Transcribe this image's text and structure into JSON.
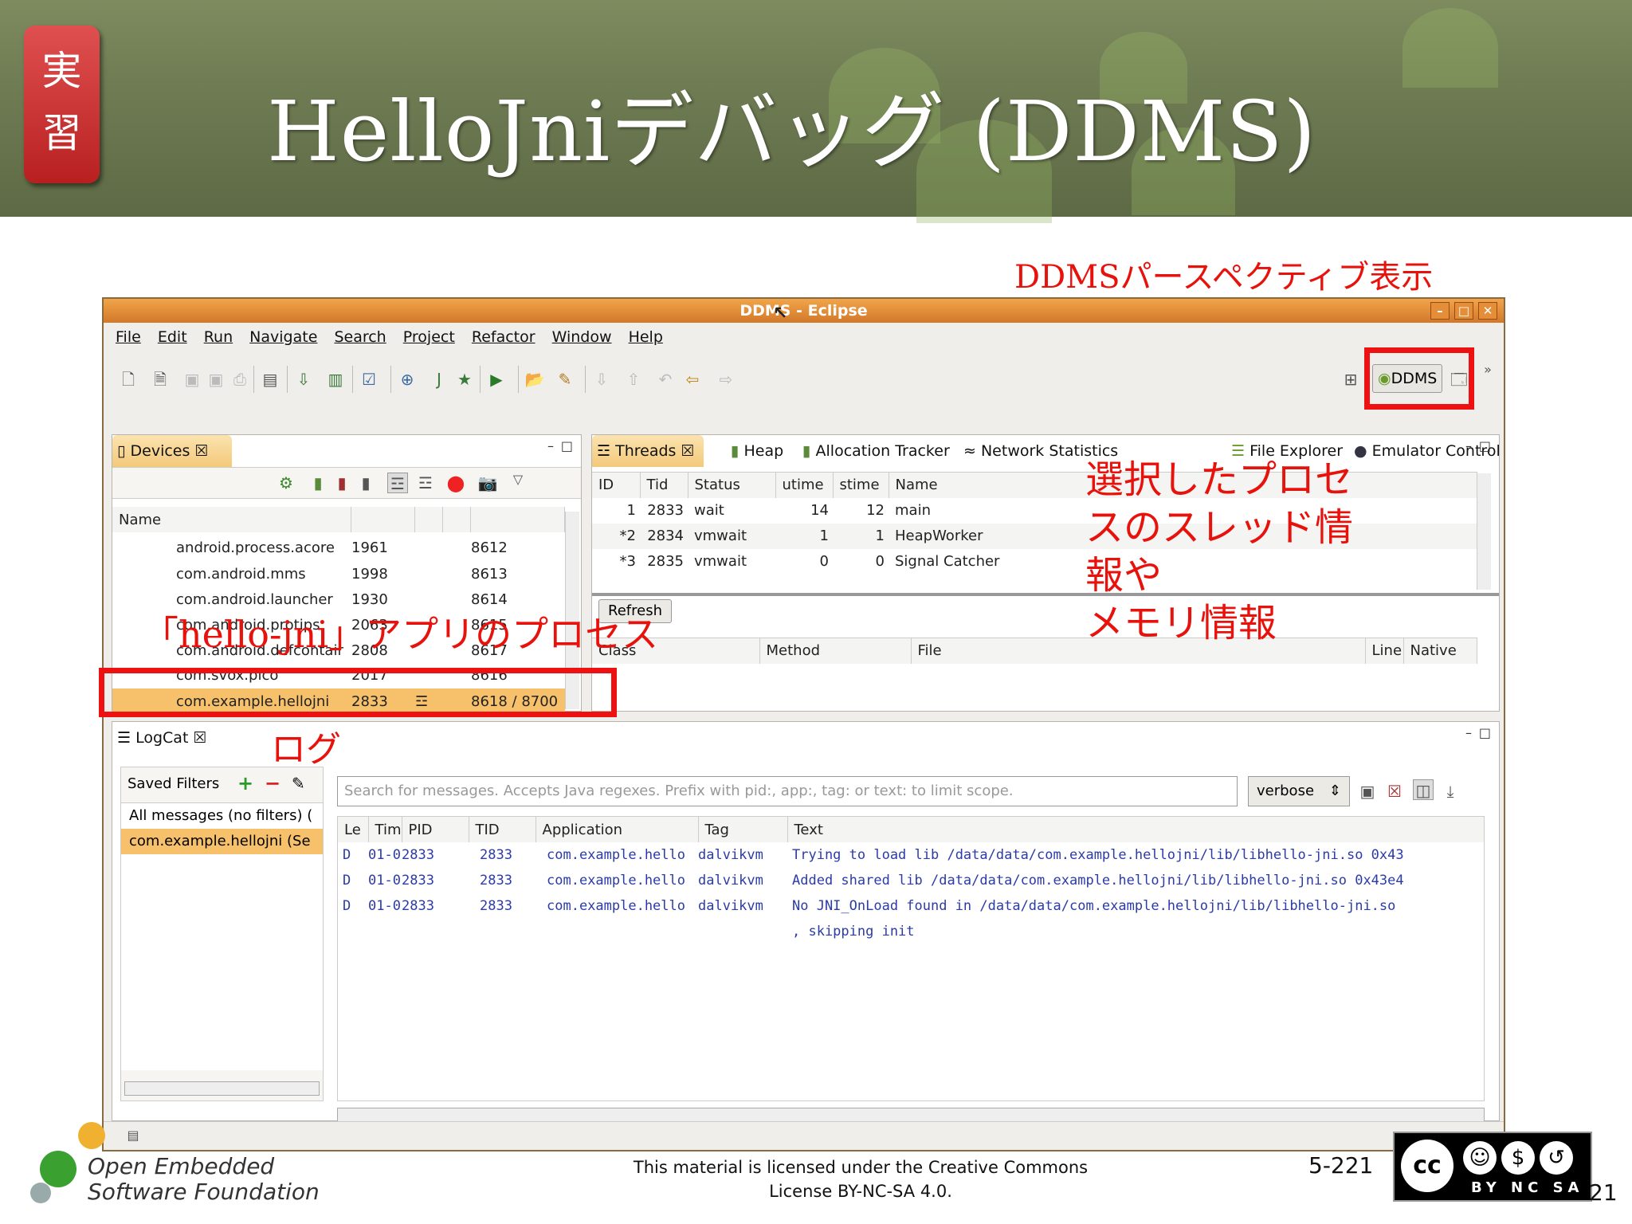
{
  "slide": {
    "badge": "実習",
    "title": "HelloJniデバッグ (DDMS)",
    "annot_perspective": "DDMSパースペクティブ表示",
    "annot_threads_l1": "選択したプロセ",
    "annot_threads_l2": "スのスレッド情",
    "annot_threads_l3": "報や",
    "annot_threads_l4": "メモリ情報",
    "annot_process": "「hello-jni」アプリのプロセス",
    "annot_log": "ログ",
    "license_l1": "This material is licensed under the Creative Commons",
    "license_l2": "License BY-NC-SA 4.0.",
    "page_number": "5-221",
    "cc_page": "21",
    "org_l1": "Open Embedded",
    "org_l2": "Software Foundation",
    "cc_badge": "BY NC SA"
  },
  "window": {
    "title": "DDMS - Eclipse",
    "menu": [
      "File",
      "Edit",
      "Run",
      "Navigate",
      "Search",
      "Project",
      "Refactor",
      "Window",
      "Help"
    ],
    "perspective_btn": "DDMS"
  },
  "devices": {
    "tab": "Devices",
    "col_name": "Name",
    "rows": [
      {
        "name": "android.process.acore",
        "pid": "1961",
        "port": "8612"
      },
      {
        "name": "com.android.mms",
        "pid": "1998",
        "port": "8613"
      },
      {
        "name": "com.android.launcher",
        "pid": "1930",
        "port": "8614"
      },
      {
        "name": "com.android.protips",
        "pid": "2063",
        "port": "8615"
      },
      {
        "name": "com.android.defcontair",
        "pid": "2808",
        "port": "8617"
      },
      {
        "name": "com.svox.pico",
        "pid": "2017",
        "port": "8616"
      },
      {
        "name": "com.example.hellojni",
        "pid": "2833",
        "port": "8618 / 8700"
      }
    ]
  },
  "threads": {
    "tabs": [
      "Threads",
      "Heap",
      "Allocation Tracker",
      "Network Statistics",
      "File Explorer",
      "Emulator Control"
    ],
    "headers": [
      "ID",
      "Tid",
      "Status",
      "utime",
      "stime",
      "Name"
    ],
    "rows": [
      {
        "id": "1",
        "tid": "2833",
        "status": "wait",
        "utime": "14",
        "stime": "12",
        "name": "main"
      },
      {
        "id": "*2",
        "tid": "2834",
        "status": "vmwait",
        "utime": "1",
        "stime": "1",
        "name": "HeapWorker"
      },
      {
        "id": "*3",
        "tid": "2835",
        "status": "vmwait",
        "utime": "0",
        "stime": "0",
        "name": "Signal Catcher"
      }
    ],
    "refresh": "Refresh",
    "stack_headers": [
      "Class",
      "Method",
      "File",
      "Line",
      "Native"
    ]
  },
  "logcat": {
    "tab": "LogCat",
    "saved_filters": "Saved Filters",
    "filters": [
      "All messages (no filters) (",
      "com.example.hellojni (Se"
    ],
    "search_placeholder": "Search for messages. Accepts Java regexes. Prefix with pid:, app:, tag: or text: to limit scope.",
    "level": "verbose",
    "headers": [
      "Le",
      "Tim",
      "PID",
      "TID",
      "Application",
      "Tag",
      "Text"
    ],
    "rows": [
      {
        "lv": "D",
        "time": "01-0",
        "pid": "2833",
        "tid": "2833",
        "app": "com.example.hello",
        "tag": "dalvikvm",
        "text": "Trying to load lib /data/data/com.example.hellojni/lib/libhello-jni.so 0x43"
      },
      {
        "lv": "D",
        "time": "01-0",
        "pid": "2833",
        "tid": "2833",
        "app": "com.example.hello",
        "tag": "dalvikvm",
        "text": "Added shared lib /data/data/com.example.hellojni/lib/libhello-jni.so 0x43e4"
      },
      {
        "lv": "D",
        "time": "01-0",
        "pid": "2833",
        "tid": "2833",
        "app": "com.example.hello",
        "tag": "dalvikvm",
        "text": "No JNI_OnLoad found in /data/data/com.example.hellojni/lib/libhello-jni.so"
      }
    ],
    "continuation": ", skipping init"
  }
}
